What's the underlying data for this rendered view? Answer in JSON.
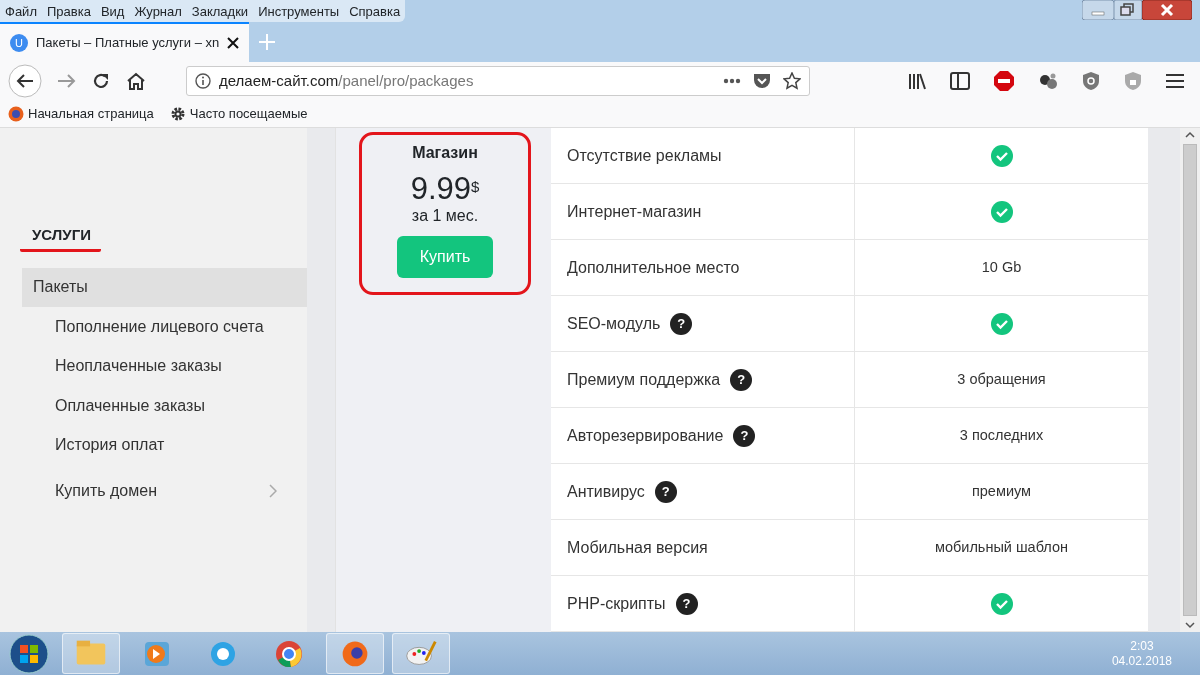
{
  "menu_bar": [
    "Файл",
    "Правка",
    "Вид",
    "Журнал",
    "Закладки",
    "Инструменты",
    "Справка"
  ],
  "tabs": [
    {
      "favicon": "U",
      "title": "Пакеты – Платные услуги – xn",
      "selected": true
    }
  ],
  "address_bar": {
    "host": "делаем-сайт.com",
    "path": "/panel/pro/packages"
  },
  "bookmarks": [
    {
      "kind": "firefox",
      "label": "Начальная страница"
    },
    {
      "kind": "gear",
      "label": "Часто посещаемые"
    }
  ],
  "sidebar": {
    "heading": "УСЛУГИ",
    "items": [
      {
        "label": "Пакеты",
        "selected": true,
        "expandable": false
      },
      {
        "label": "Пополнение лицевого счета",
        "selected": false,
        "expandable": false
      },
      {
        "label": "Неоплаченные заказы",
        "selected": false,
        "expandable": false
      },
      {
        "label": "Оплаченные заказы",
        "selected": false,
        "expandable": false
      },
      {
        "label": "История оплат",
        "selected": false,
        "expandable": false
      },
      {
        "label": "Купить домен",
        "selected": false,
        "expandable": true
      }
    ]
  },
  "package": {
    "name": "Магазин",
    "price": "9.99",
    "currency": "$",
    "period": "за 1 мес.",
    "button": "Купить"
  },
  "features": [
    {
      "name": "Отсутствие рекламы",
      "kind": "check"
    },
    {
      "name": "Интернет-магазин",
      "kind": "check"
    },
    {
      "name": "Дополнительное место",
      "kind": "text",
      "value": "10 Gb"
    },
    {
      "name": "SEO-модуль",
      "help": "?",
      "kind": "check"
    },
    {
      "name": "Премиум поддержка",
      "help": "?",
      "kind": "text",
      "value": "3 обращения"
    },
    {
      "name": "Авторезервирование",
      "help": "?",
      "kind": "text",
      "value": "3 последних"
    },
    {
      "name": "Антивирус",
      "help": "?",
      "kind": "text",
      "value": "премиум"
    },
    {
      "name": "Мобильная версия",
      "kind": "text",
      "value": "мобильный шаблон"
    },
    {
      "name": "PHP-скрипты",
      "help": "?",
      "kind": "check"
    }
  ],
  "taskbar": {
    "clock_time": "2:03",
    "clock_date": "04.02.2018"
  }
}
